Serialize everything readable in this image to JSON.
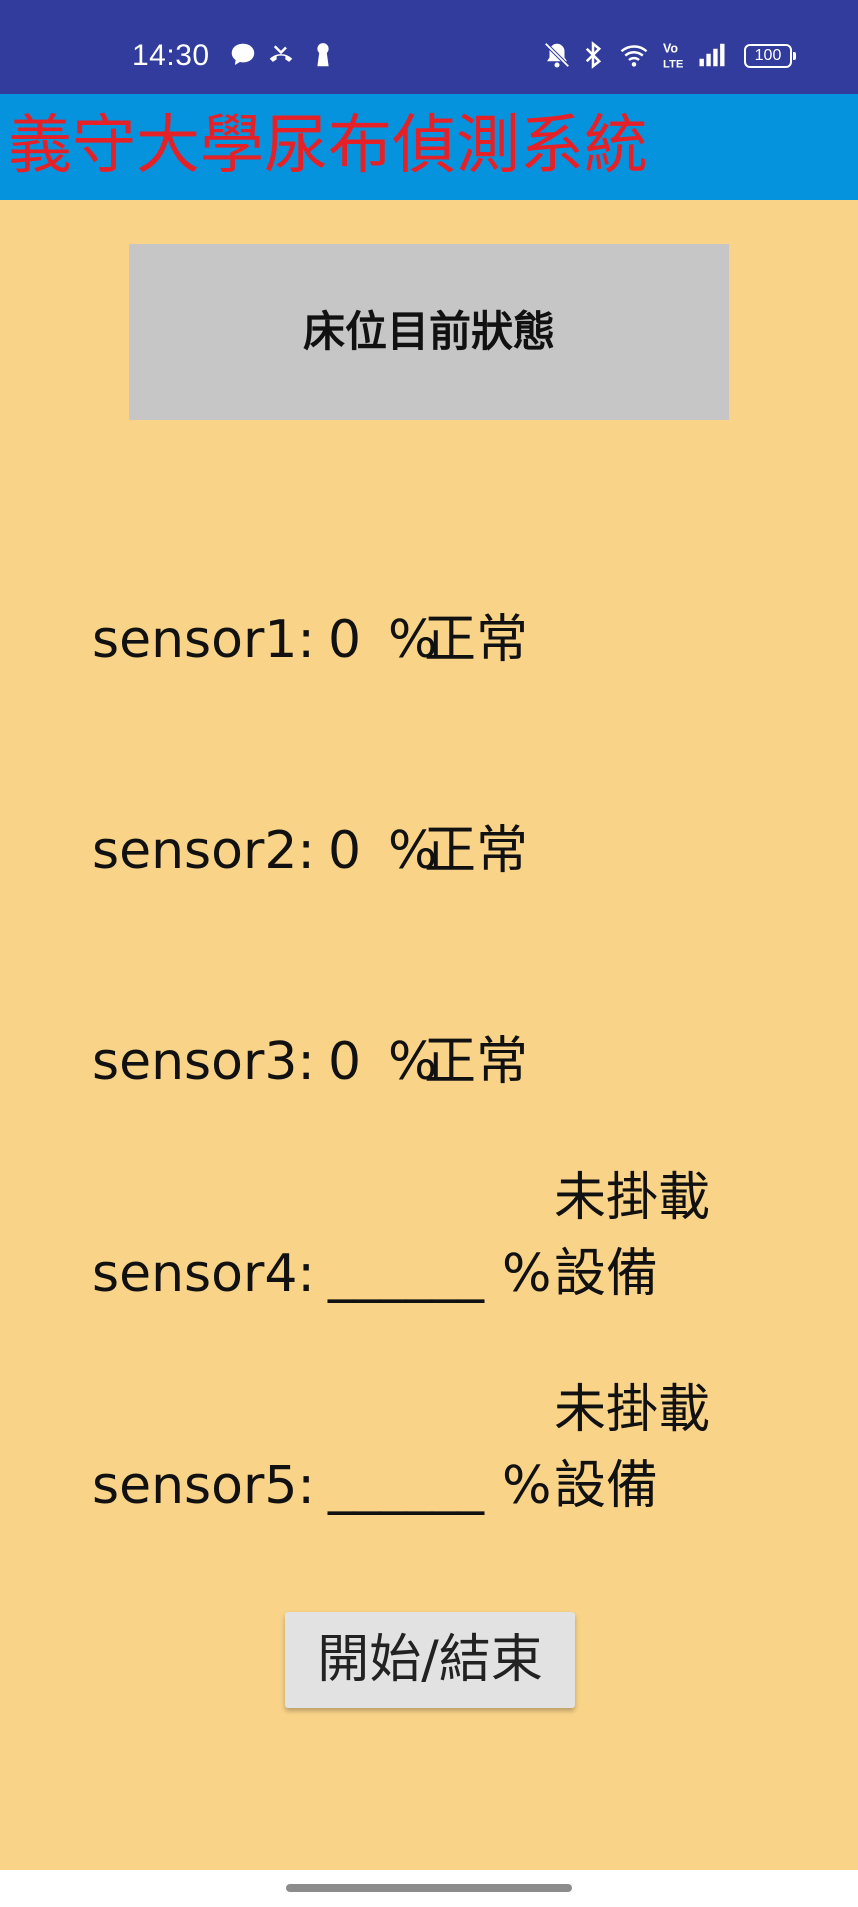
{
  "status_bar": {
    "time": "14:30",
    "battery": "100",
    "left_icons": [
      "chat-bubble-icon",
      "missed-call-icon",
      "keyhole-icon"
    ],
    "right_icons": [
      "mute-icon",
      "bluetooth-icon",
      "wifi-icon",
      "volte-icon",
      "signal-icon",
      "battery-icon"
    ]
  },
  "app": {
    "title": "義守大學尿布偵測系統"
  },
  "bed_status_button": {
    "label": "床位目前狀態"
  },
  "sensors": [
    {
      "label": "sensor1:",
      "value": "0",
      "unit": "%",
      "status": "正常"
    },
    {
      "label": "sensor2:",
      "value": "0",
      "unit": "%",
      "status": "正常"
    },
    {
      "label": "sensor3:",
      "value": "0",
      "unit": "%",
      "status": "正常"
    },
    {
      "label": "sensor4:",
      "value": "______",
      "unit": "%",
      "status": "未掛載設備"
    },
    {
      "label": "sensor5:",
      "value": "______",
      "unit": "%",
      "status": "未掛載設備"
    }
  ],
  "start_stop_button": {
    "label": "開始/結束"
  },
  "colors": {
    "status_bar": "#313c9c",
    "title_bar": "#0593de",
    "title_text": "#e52127",
    "background": "#f8d388",
    "button_gray": "#c6c6c6"
  }
}
